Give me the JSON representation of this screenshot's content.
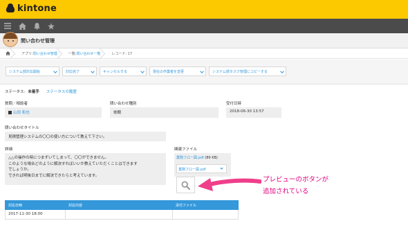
{
  "header": {
    "logo_text": "kintone"
  },
  "nav": {
    "icons": [
      "menu-icon",
      "home-icon",
      "bell-icon",
      "star-icon"
    ]
  },
  "app": {
    "title": "問い合わせ管理"
  },
  "breadcrumb": {
    "app_prefix": "アプリ: ",
    "app_link": "問い合わせ管理",
    "list_prefix": "一覧: ",
    "list_link": "問い合わせ一覧",
    "record": "レコード: 17"
  },
  "toolbar": {
    "buttons": [
      "システム部対応開始",
      "対応完了",
      "キャンセルする",
      "現在の作業者を変更",
      "システム部タスク管理にコピーする"
    ]
  },
  "status": {
    "label": "ステータス: ",
    "value": "未着手",
    "history": "ステータスの履歴"
  },
  "fields": {
    "requester_label": "質問／相談者",
    "requester_value": "山田 和也",
    "type_label": "問い合わせ種別",
    "type_value": "依頼",
    "date_label": "受付日時",
    "date_value": "2018-06-30 13:57",
    "title_label": "問い合わせタイトル",
    "title_value": "見積管理システムの〇〇の使い方について教えて下さい。",
    "detail_label": "詳細",
    "detail_lines": [
      "△△の操作の時につまずいてしまって、〇〇ができません。",
      "このような場合どのように解決すればいいか教えていただくことはできます",
      "でしょうか。",
      "できれば明後日までに解決できたらと考えています。"
    ],
    "files_label": "関連ファイル",
    "file_name": "業務フロー図.pdf",
    "file_size": " (89 KB)",
    "file_dropdown": "業務フロー図.pdf"
  },
  "table": {
    "headers": [
      "対応日時",
      "対応内容",
      "添付ファイル"
    ],
    "rows": [
      [
        "2017-11-30 18:00",
        "",
        ""
      ]
    ]
  },
  "callout": {
    "line1": "プレビューのボタンが",
    "line2": "追加されている"
  },
  "colors": {
    "brand": "#fcc800",
    "accent": "#3498db",
    "callout": "#e4007f"
  }
}
